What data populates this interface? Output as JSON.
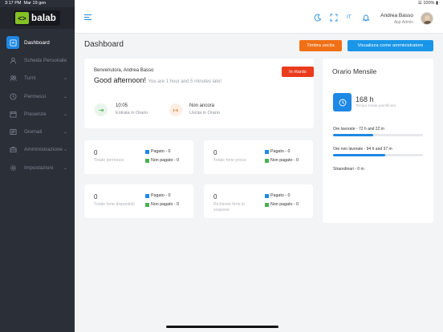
{
  "statusbar": {
    "time": "3:17 PM",
    "date": "Mar 19 gen",
    "battery": "100%"
  },
  "brand": {
    "name": "balab"
  },
  "sidebar": {
    "items": [
      {
        "label": "Dashboard",
        "icon": "dashboard-icon",
        "active": true,
        "has_chevron": false
      },
      {
        "label": "Scheda Personale",
        "icon": "user-icon",
        "active": false,
        "has_chevron": false
      },
      {
        "label": "Turni",
        "icon": "people-icon",
        "active": false,
        "has_chevron": true
      },
      {
        "label": "Permessi",
        "icon": "clock-icon",
        "active": false,
        "has_chevron": true
      },
      {
        "label": "Presenze",
        "icon": "calendar-icon",
        "active": false,
        "has_chevron": true
      },
      {
        "label": "Giornali",
        "icon": "newspaper-icon",
        "active": false,
        "has_chevron": true
      },
      {
        "label": "Amministrazione",
        "icon": "briefcase-icon",
        "active": false,
        "has_chevron": true
      },
      {
        "label": "Impostazioni",
        "icon": "gear-icon",
        "active": false,
        "has_chevron": true
      }
    ]
  },
  "header": {
    "user_name": "Andrea Basso",
    "user_role": "App Admin"
  },
  "page": {
    "title": "Dashboard",
    "btn_exit": "Timbra uscita",
    "btn_admin": "Visualizza come amministratore"
  },
  "welcome": {
    "greeting": "Benvenuto/a, Andrea Basso",
    "headline": "Good afternoon!",
    "late_note": "You are 1 hour and 5 minutes late!",
    "badge": "In ritardo",
    "entry_time": "10:05",
    "entry_label": "Entrata in Orario",
    "exit_time": "Non ancora",
    "exit_label": "Uscita in Orario"
  },
  "stats": [
    {
      "value": "0",
      "label": "Totale permessi",
      "paid": "Pagato - 0",
      "unpaid": "Non pagato - 0"
    },
    {
      "value": "0",
      "label": "Totale ferie prese",
      "paid": "Pagato - 0",
      "unpaid": "Non pagato - 0"
    },
    {
      "value": "0",
      "label": "Totale ferie disponibili",
      "paid": "Pagato - 0",
      "unpaid": "Non pagato - 0"
    },
    {
      "value": "0",
      "label": "Richieste ferie in sospeso",
      "paid": "Pagato - 0",
      "unpaid": "Non pagato - 0"
    }
  ],
  "monthly": {
    "title": "Orario Mensile",
    "hours": "168 h",
    "hours_label": "Tempo totale pianificato",
    "worked_label": "Ore lavorate - 72 h and 22 m",
    "worked_fraction": 0.45,
    "not_worked_label": "Ore non lavorate - 94 h and 37 m",
    "not_worked_fraction": 0.58,
    "overtime_label": "Straordinari - 0 m",
    "overtime_fraction": 0
  },
  "colors": {
    "accent": "#1e88e5",
    "exit": "#f07017",
    "late": "#ea3b1c",
    "paid": "#1e88e5",
    "unpaid": "#4caf50"
  }
}
